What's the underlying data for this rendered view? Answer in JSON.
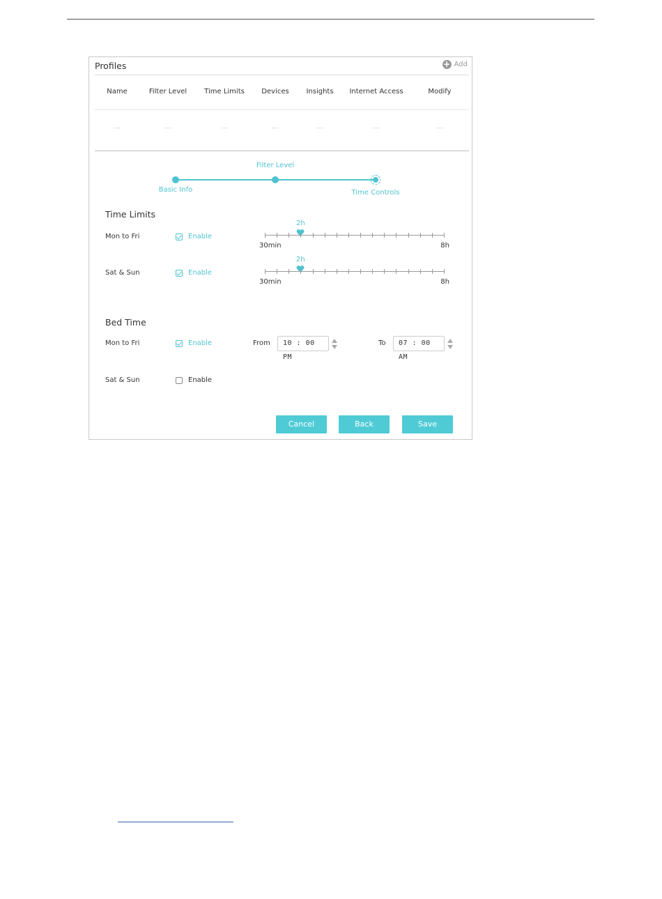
{
  "profiles": {
    "title": "Profiles",
    "add_label": "Add",
    "columns": [
      "Name",
      "Filter Level",
      "Time Limits",
      "Devices",
      "Insights",
      "Internet Access",
      "Modify"
    ],
    "row": [
      "---",
      "---",
      "---",
      "---",
      "---",
      "---",
      "---"
    ]
  },
  "stepper": {
    "steps": [
      "Basic Info",
      "Filter Level",
      "Time Controls"
    ],
    "active": "Time Controls"
  },
  "time_limits": {
    "title": "Time Limits",
    "weekday": {
      "label": "Mon to Fri",
      "enable_label": "Enable",
      "enabled": true,
      "value": "2h",
      "min_label": "30min",
      "max_label": "8h",
      "value_hours": 2
    },
    "weekend": {
      "label": "Sat & Sun",
      "enable_label": "Enable",
      "enabled": true,
      "value": "2h",
      "min_label": "30min",
      "max_label": "8h",
      "value_hours": 2
    }
  },
  "bed_time": {
    "title": "Bed Time",
    "weekday": {
      "label": "Mon to Fri",
      "enable_label": "Enable",
      "enabled": true,
      "from_label": "From",
      "from_value": "10 : 00  PM",
      "to_label": "To",
      "to_value": "07 : 00  AM"
    },
    "weekend": {
      "label": "Sat & Sun",
      "enable_label": "Enable",
      "enabled": false
    }
  },
  "buttons": {
    "cancel": "Cancel",
    "back": "Back",
    "save": "Save"
  },
  "colors": {
    "accent": "#4fc3d0",
    "button": "#4fcbd6"
  }
}
